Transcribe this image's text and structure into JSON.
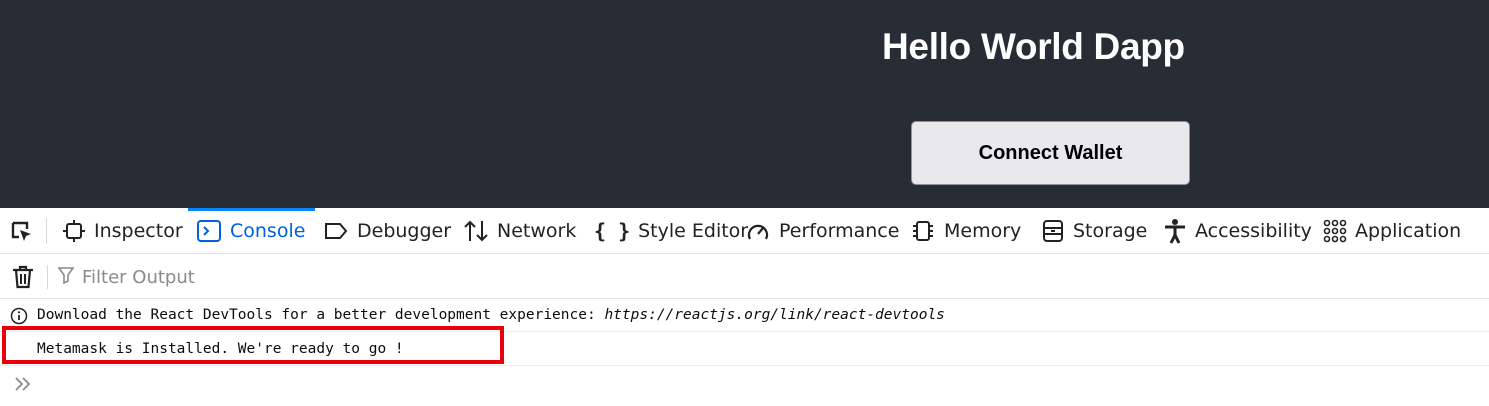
{
  "app": {
    "title": "Hello World Dapp",
    "connect_button": "Connect Wallet"
  },
  "devtools": {
    "tabs": [
      {
        "label": "Inspector",
        "icon": "inspector-icon"
      },
      {
        "label": "Console",
        "icon": "console-icon",
        "active": true
      },
      {
        "label": "Debugger",
        "icon": "debugger-icon"
      },
      {
        "label": "Network",
        "icon": "network-icon"
      },
      {
        "label": "Style Editor",
        "icon": "style-editor-icon"
      },
      {
        "label": "Performance",
        "icon": "performance-icon"
      },
      {
        "label": "Memory",
        "icon": "memory-icon"
      },
      {
        "label": "Storage",
        "icon": "storage-icon"
      },
      {
        "label": "Accessibility",
        "icon": "accessibility-icon"
      },
      {
        "label": "Application",
        "icon": "application-icon"
      }
    ],
    "filter": {
      "placeholder": "Filter Output"
    },
    "console": {
      "messages": [
        {
          "type": "info",
          "text": "Download the React DevTools for a better development experience: ",
          "link": "https://reactjs.org/link/react-devtools"
        },
        {
          "type": "log",
          "text": "Metamask is Installed. We're ready to go !"
        }
      ],
      "prompt_icon": "chevron-double-right-icon"
    }
  },
  "colors": {
    "app_background": "#282c34",
    "active_tab": "#0060df",
    "highlight_box": "#e8000b"
  }
}
